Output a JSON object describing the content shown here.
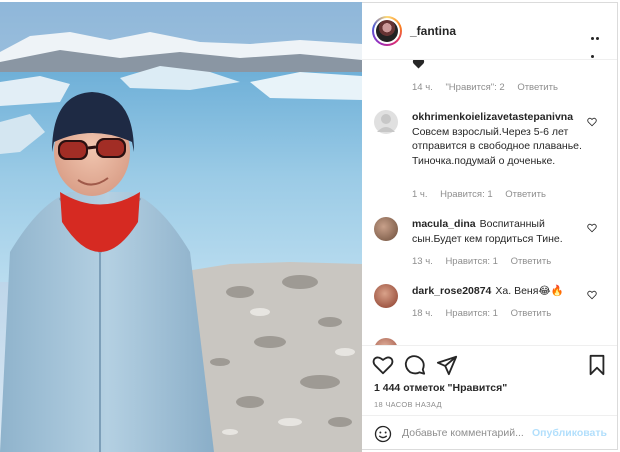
{
  "post": {
    "username": "_fantina",
    "likes_text": "1 444 отметок \"Нравится\"",
    "time_text": "18 ЧАСОВ НАЗАД"
  },
  "comments": [
    {
      "username": "",
      "text": "",
      "meta": {
        "time": "14 ч.",
        "likes": "\"Нравится\": 2",
        "reply": "Ответить"
      }
    },
    {
      "username": "okhrimenkoielizavetastepanivna",
      "text": "Совсем взрослый.Через 5-6 лет отправится в свободное плаванье. Тиночка.подумай о доченьке.",
      "meta": {
        "time": "1 ч.",
        "likes": "Нравится: 1",
        "reply": "Ответить"
      }
    },
    {
      "username": "macula_dina",
      "text": "Воспитанный сын.Будет кем гордиться Тине.",
      "meta": {
        "time": "13 ч.",
        "likes": "Нравится: 1",
        "reply": "Ответить"
      }
    },
    {
      "username": "dark_rose20874",
      "text": "Ха. Веня😂🔥",
      "meta": {
        "time": "18 ч.",
        "likes": "Нравится: 1",
        "reply": "Ответить"
      }
    }
  ],
  "add_comment": {
    "placeholder": "Добавьте комментарий...",
    "publish_label": "Опубликовать"
  },
  "icons": {
    "more": "more-dots-icon",
    "like": "heart-icon",
    "comment": "comment-icon",
    "share": "send-icon",
    "save": "bookmark-icon",
    "emoji": "emoji-icon"
  },
  "colors": {
    "accent": "#0095f6",
    "publish_disabled": "#b2dffc",
    "muted_text": "#8e8e8e",
    "border": "#dbdbdb"
  }
}
